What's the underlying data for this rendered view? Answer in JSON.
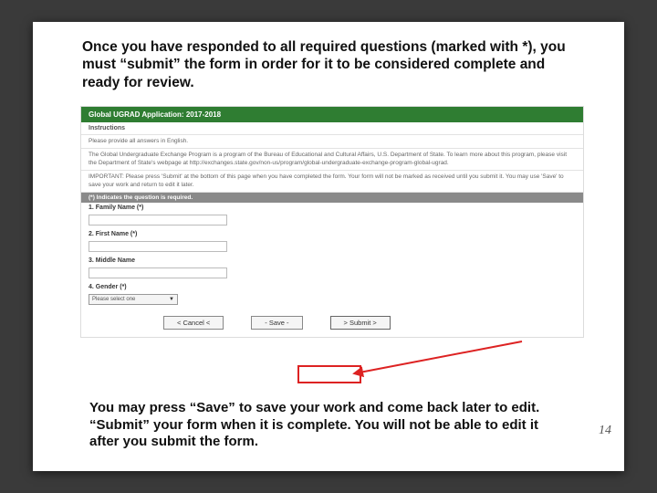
{
  "intro": "Once you have responded to all required questions (marked with *), you must “submit” the form in order for it to be considered complete and ready for review.",
  "form": {
    "title": "Global UGRAD Application: 2017-2018",
    "instructions_label": "Instructions",
    "line1": "Please provide all answers in English.",
    "line2": "The Global Undergraduate Exchange Program is a program of the Bureau of Educational and Cultural Affairs, U.S. Department of State. To learn more about this program, please visit the Department of State's webpage at http://exchanges.state.gov/non-us/program/global-undergraduate-exchange-program-global-ugrad.",
    "line3": "IMPORTANT: Please press 'Submit' at the bottom of this page when you have completed the form. Your form will not be marked as received until you submit it. You may use 'Save' to save your work and return to edit it later.",
    "required_note": "(*) Indicates the question is required.",
    "fields": {
      "family": "1. Family Name (*)",
      "first": "2. First Name (*)",
      "middle": "3. Middle Name",
      "gender": "4. Gender (*)",
      "select_placeholder": "Please select one"
    },
    "buttons": {
      "cancel": "< Cancel <",
      "save": "- Save -",
      "submit": "> Submit >"
    }
  },
  "outro": "You may press “Save” to save your work and come back later to edit. “Submit” your form when it is complete. You will not be able to edit it after you submit the form.",
  "page_number": "14"
}
